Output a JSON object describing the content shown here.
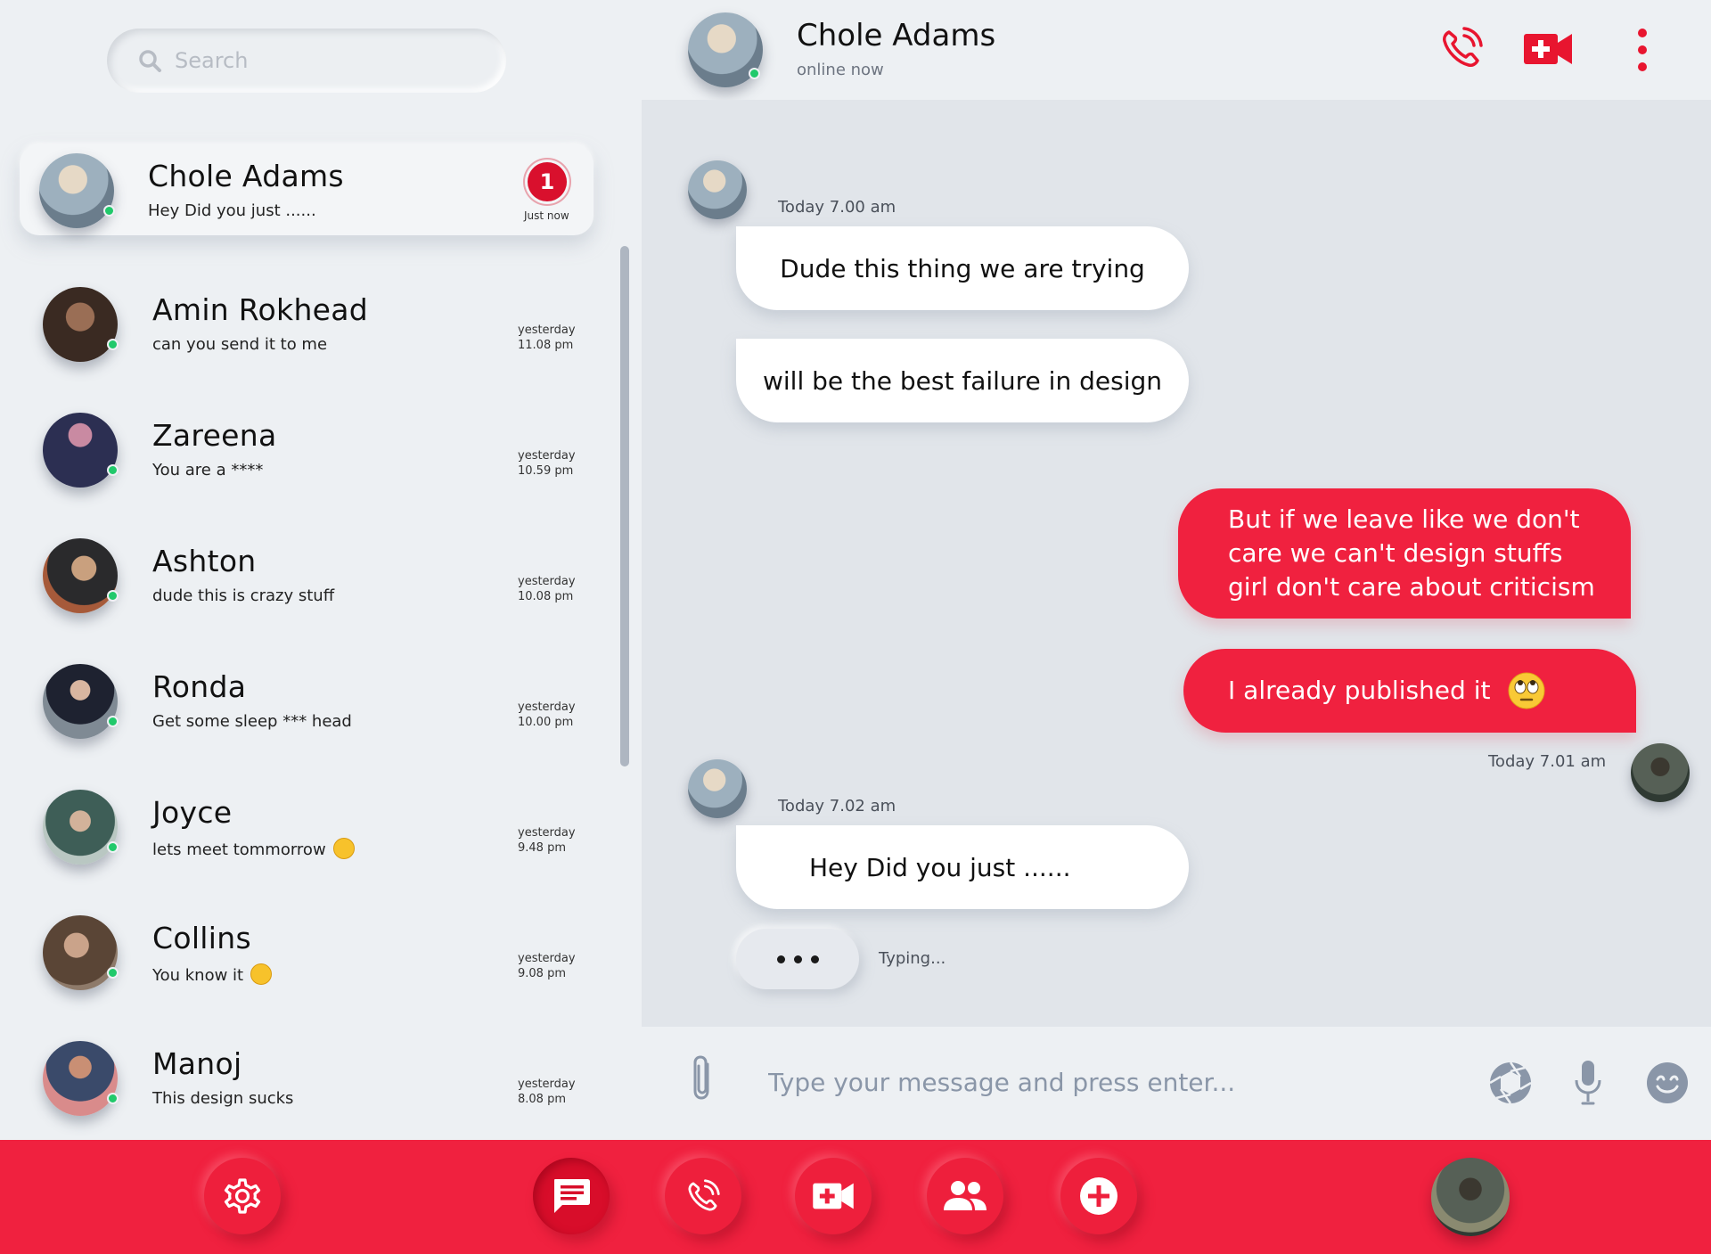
{
  "search": {
    "placeholder": "Search"
  },
  "contacts": [
    {
      "name": "Chole Adams",
      "message": "Hey Did you just ......",
      "time_line1": "Just now",
      "time_line2": "",
      "unread": "1",
      "online": true,
      "avatar_colors": [
        "#9db0be",
        "#d8c9b4"
      ]
    },
    {
      "name": "Amin Rokhead",
      "message": "can you send it to me",
      "time_line1": "yesterday",
      "time_line2": "11.08 pm",
      "online": true,
      "avatar_colors": [
        "#3a2a22",
        "#7b5b47"
      ]
    },
    {
      "name": "Zareena",
      "message": "You are a ****",
      "time_line1": "yesterday",
      "time_line2": "10.59 pm",
      "online": true,
      "avatar_colors": [
        "#2c2f52",
        "#b06a8a"
      ]
    },
    {
      "name": "Ashton",
      "message": "dude this is crazy stuff",
      "time_line1": "yesterday",
      "time_line2": "10.08 pm",
      "online": true,
      "avatar_colors": [
        "#2a2a2c",
        "#a65a3a"
      ]
    },
    {
      "name": "Ronda",
      "message": "Get some sleep *** head",
      "time_line1": "yesterday",
      "time_line2": "10.00 pm",
      "online": true,
      "avatar_colors": [
        "#7f8a94",
        "#1e2230"
      ]
    },
    {
      "name": "Joyce",
      "message": "lets meet tommorrow",
      "time_line1": "yesterday",
      "time_line2": "9.48 pm",
      "online": true,
      "avatar_colors": [
        "#3e5e57",
        "#b9c7c2"
      ],
      "emoji": "yawn"
    },
    {
      "name": "Collins",
      "message": "You know it",
      "time_line1": "yesterday",
      "time_line2": "9.08 pm",
      "online": true,
      "avatar_colors": [
        "#5a4536",
        "#caa38a"
      ],
      "emoji": "wink"
    },
    {
      "name": "Manoj",
      "message": "This design sucks",
      "time_line1": "yesterday",
      "time_line2": "8.08 pm",
      "online": true,
      "avatar_colors": [
        "#d98b8b",
        "#3a4a6a"
      ]
    }
  ],
  "chat": {
    "name": "Chole Adams",
    "status": "online now",
    "header_icons": [
      "phone-call-icon",
      "video-call-icon",
      "more-vertical-icon"
    ],
    "messages": [
      {
        "from": "them",
        "stamp": "Today 7.00 am",
        "text": "Dude this thing we are trying"
      },
      {
        "from": "them",
        "text": "will be the best failure in design"
      },
      {
        "from": "me",
        "text": "But if we leave like we don't care we can't design stuffs girl don't care about criticism"
      },
      {
        "from": "me",
        "text": "I already published it",
        "emoji": "eye-roll"
      },
      {
        "from": "me",
        "stamp": "Today 7.01 am"
      },
      {
        "from": "them",
        "stamp": "Today 7.02 am",
        "text": "Hey Did you just ......"
      }
    ],
    "typing_label": "Typing..."
  },
  "composer": {
    "placeholder": "Type your message and press enter...",
    "icons": [
      "attach-icon",
      "camera-shutter-icon",
      "microphone-icon",
      "emoji-icon"
    ]
  },
  "bottom_nav": {
    "items": [
      "settings-icon",
      "chat-icon",
      "phone-icon",
      "video-icon",
      "contacts-icon",
      "add-icon"
    ],
    "active": "chat-icon"
  },
  "colors": {
    "accent": "#f0213f",
    "badge": "#d9102d",
    "online": "#21c96b",
    "chat_bg": "#e1e5ea",
    "panel_bg": "#edf0f3"
  }
}
